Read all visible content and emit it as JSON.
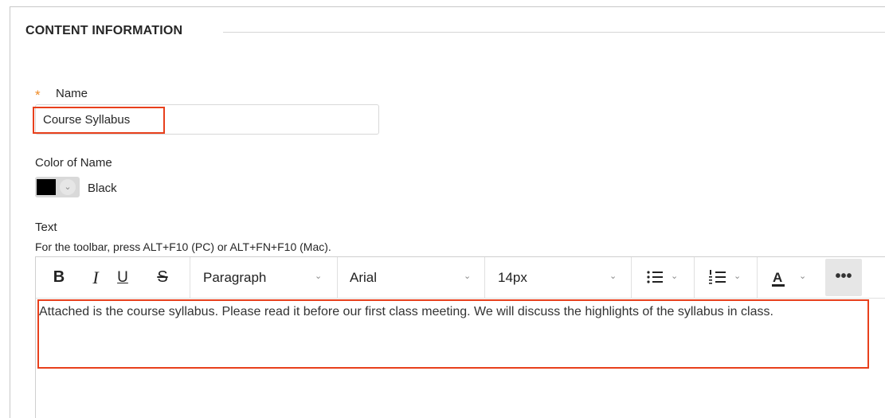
{
  "section": {
    "title": "CONTENT INFORMATION"
  },
  "name_field": {
    "required_marker": "*",
    "label": "Name",
    "value": "Course Syllabus"
  },
  "color_field": {
    "label": "Color of Name",
    "swatch_color": "#000000",
    "value": "Black"
  },
  "text_field": {
    "label": "Text",
    "hint": "For the toolbar, press ALT+F10 (PC) or ALT+FN+F10 (Mac)."
  },
  "toolbar": {
    "bold": "B",
    "italic": "I",
    "underline": "U",
    "strikethrough": "S",
    "paragraph_format": "Paragraph",
    "font_family": "Arial",
    "font_size": "14px",
    "text_color": "A",
    "more": "•••"
  },
  "editor": {
    "content": "Attached is the course syllabus. Please read it before our first class meeting. We will discuss the highlights of the syllabus in class."
  },
  "colors": {
    "highlight": "#e8401c",
    "required": "#f08a24"
  }
}
